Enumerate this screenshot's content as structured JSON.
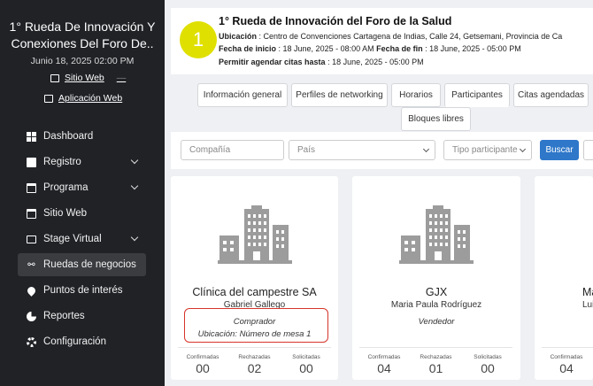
{
  "sidebar": {
    "event_title": "1° Rueda De Innovación Y Conexiones Del Foro De..",
    "event_date": "Junio 18, 2025 02:00 PM",
    "site_link": "Sitio Web",
    "site_link_extra": "—",
    "app_link": "Aplicación Web",
    "nav": [
      {
        "label": "Dashboard",
        "icon": "dashboard-icon",
        "submenu": false
      },
      {
        "label": "Registro",
        "icon": "ticket-icon",
        "submenu": true
      },
      {
        "label": "Programa",
        "icon": "calendar-icon",
        "submenu": true
      },
      {
        "label": "Sitio Web",
        "icon": "website-icon",
        "submenu": false
      },
      {
        "label": "Stage Virtual",
        "icon": "monitor-icon",
        "submenu": true
      },
      {
        "label": "Ruedas de negocios",
        "icon": "handshake-icon",
        "submenu": false,
        "active": true
      },
      {
        "label": "Puntos de interés",
        "icon": "map-pin-icon",
        "submenu": false
      },
      {
        "label": "Reportes",
        "icon": "pie-chart-icon",
        "submenu": false
      },
      {
        "label": "Configuración",
        "icon": "gear-icon",
        "submenu": false
      }
    ]
  },
  "header": {
    "number": "1",
    "title": "1° Rueda de Innovación del Foro de la Salud",
    "location_label": "Ubicación",
    "location_value": " : Centro de Convenciones Cartagena de Indias, Calle 24, Getsemani, Provincia de Ca",
    "start_label": "Fecha de inicio",
    "start_value": " : 18 June, 2025 - 08:00 AM ",
    "end_label": "Fecha de fin",
    "end_value": " : 18 June, 2025 - 05:00 PM",
    "allow_label": "Permitir agendar citas hasta",
    "allow_value": ": 18 June, 2025 - 05:00 PM"
  },
  "tabs": [
    "Información general",
    "Perfiles de networking",
    "Horarios",
    "Participantes",
    "Citas agendadas",
    "Bloques libres"
  ],
  "active_tab": "Participantes",
  "filters": {
    "company_placeholder": "Compañía",
    "country_placeholder": "País",
    "type_placeholder": "Tipo participante",
    "search_button": "Buscar"
  },
  "participants": [
    {
      "company": "Clínica del campestre SA",
      "person": "Gabriel Gallego",
      "role": "Comprador",
      "location": "Ubicación: Número de mesa 1",
      "confirmed_label": "Confirmadas",
      "confirmed": "00",
      "rejected_label": "Rechazadas",
      "rejected": "02",
      "requested_label": "Solicitadas",
      "requested": "00"
    },
    {
      "company": "GJX",
      "person": "Maria Paula Rodríguez",
      "role": "Vendedor",
      "location": "",
      "confirmed_label": "Confirmadas",
      "confirmed": "04",
      "rejected_label": "Rechazadas",
      "rejected": "01",
      "requested_label": "Solicitadas",
      "requested": "00"
    },
    {
      "company": "Ma",
      "person": "Lui",
      "role": "",
      "location": "",
      "confirmed_label": "Confirmadas",
      "confirmed": "04",
      "rejected_label": "",
      "rejected": "",
      "requested_label": "",
      "requested": ""
    }
  ],
  "colors": {
    "sidebar_bg": "#202226",
    "accent_circle": "#dfe000",
    "primary_button": "#2e77c9",
    "highlight_border": "#d6342a"
  }
}
